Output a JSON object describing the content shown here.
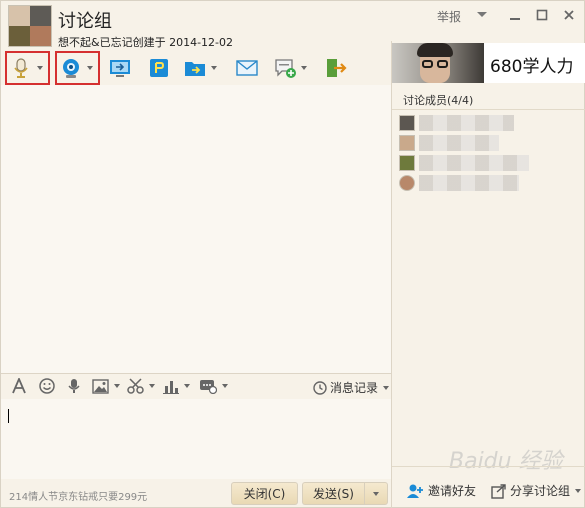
{
  "window": {
    "title": "讨论组",
    "subtitle": "想不起&已忘记创建于 2014-12-02",
    "report_label": "举报",
    "controls": [
      "chevron-down-icon",
      "minimize-icon",
      "maximize-icon",
      "close-icon"
    ]
  },
  "toolbar": {
    "items": [
      "microphone-icon",
      "webcam-icon",
      "screen-share-icon",
      "bookmark-icon",
      "send-file-icon",
      "email-icon",
      "message-add-icon",
      "exit-icon"
    ],
    "highlight_color": "#d53030"
  },
  "input_toolbar": {
    "items": [
      "font-icon",
      "emoji-icon",
      "voice-icon",
      "image-icon",
      "scissors-icon",
      "chart-icon",
      "screenshot-more-icon"
    ],
    "history_label": "消息记录"
  },
  "bottom": {
    "ad_text": "214情人节京东钻戒只要299元",
    "close_label": "关闭(C)",
    "send_label": "发送(S)"
  },
  "right_panel": {
    "banner_text": "680学人力",
    "members_title": "讨论成员(4/4)",
    "members": [
      {
        "blurred": true
      },
      {
        "blurred": true
      },
      {
        "blurred": true
      },
      {
        "blurred": true
      }
    ],
    "invite_label": "邀请好友",
    "share_label": "分享讨论组"
  },
  "watermark": "Baidu 经验",
  "colors": {
    "background": "#f7f2e8",
    "accent_blue": "#1b8bd6",
    "button": "#ecdcb9"
  }
}
